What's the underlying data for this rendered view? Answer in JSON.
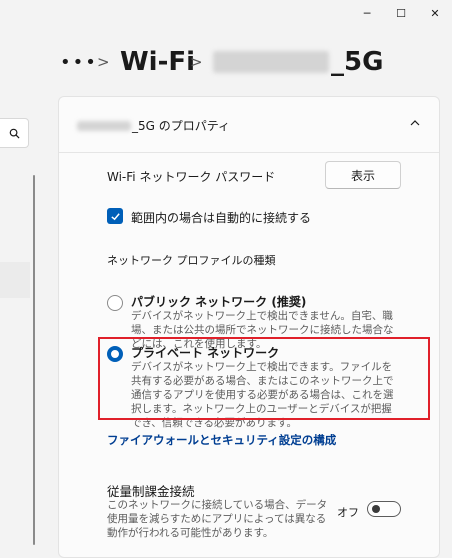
{
  "window": {
    "minimize_glyph": "─",
    "maximize_glyph": "☐",
    "close_glyph": "✕"
  },
  "breadcrumb": {
    "more": "•••",
    "chevron": ">",
    "title": "Wi-Fi",
    "network_suffix": "_5G"
  },
  "panel": {
    "header": {
      "title_suffix": "_5G のプロパティ",
      "collapse_glyph": "⌃"
    },
    "password_label": "Wi-Fi ネットワーク パスワード",
    "show_button_label": "表示",
    "auto_connect_label": "範囲内の場合は自動的に接続する",
    "profile_type_label": "ネットワーク プロファイルの種類",
    "public": {
      "title": "パブリック ネットワーク (推奨)",
      "desc": "デバイスがネットワーク上で検出できません。自宅、職場、または公共の場所でネットワークに接続した場合などには、これを使用します。"
    },
    "private": {
      "title": "プライベート ネットワーク",
      "desc": "デバイスがネットワーク上で検出できます。ファイルを共有する必要がある場合、またはこのネットワーク上で通信するアプリを使用する必要がある場合は、これを選択します。ネットワーク上のユーザーとデバイスが把握でき、信頼できる必要があります。"
    },
    "firewall_link": "ファイアウォールとセキュリティ設定の構成",
    "metered": {
      "title": "従量制課金接続",
      "desc": "このネットワークに接続している場合、データ使用量を減らすためにアプリによっては異なる動作が行われる可能性があります。",
      "state_label": "オフ"
    }
  },
  "colors": {
    "accent": "#005fb8",
    "highlight_border": "#e0202a",
    "link": "#003e92"
  }
}
